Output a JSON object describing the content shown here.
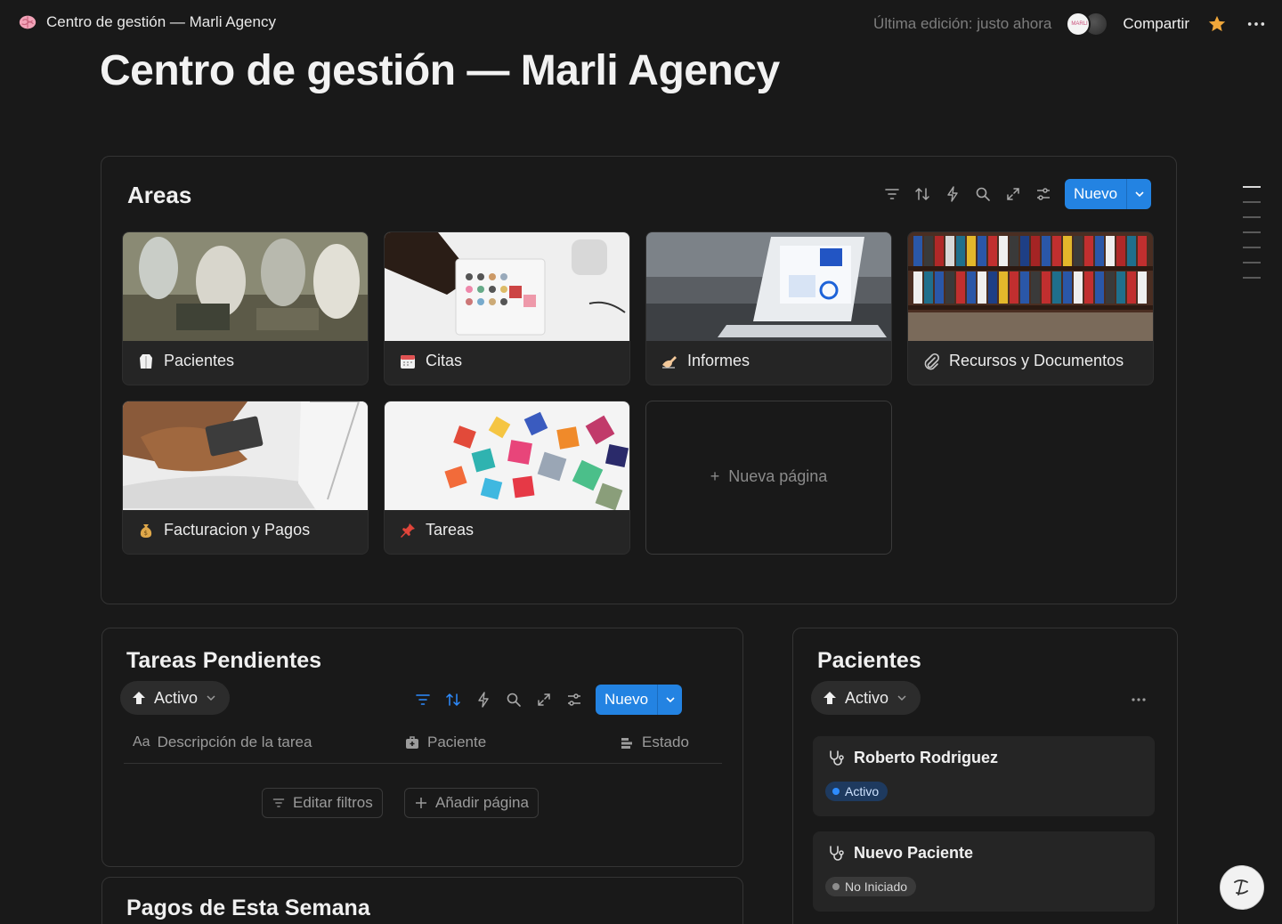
{
  "topbar": {
    "breadcrumb": "Centro de gestión — Marli Agency",
    "last_edit": "Última edición: justo ahora",
    "avatar_label": "MARLI",
    "share": "Compartir"
  },
  "page": {
    "title": "Centro de gestión — Marli Agency"
  },
  "areas": {
    "title": "Areas",
    "new_label": "Nuevo",
    "cards": [
      {
        "label": "Pacientes",
        "icon": "lab-coat-icon"
      },
      {
        "label": "Citas",
        "icon": "calendar-icon"
      },
      {
        "label": "Informes",
        "icon": "writing-hand-icon"
      },
      {
        "label": "Recursos y Documentos",
        "icon": "paperclip-icon"
      },
      {
        "label": "Facturacion y Pagos",
        "icon": "money-bag-icon"
      },
      {
        "label": "Tareas",
        "icon": "pushpin-icon"
      }
    ],
    "new_page": "Nueva página"
  },
  "tareas": {
    "title": "Tareas Pendientes",
    "filter_chip": "Activo",
    "new_label": "Nuevo",
    "columns": [
      "Descripción de la tarea",
      "Paciente",
      "Estado"
    ],
    "edit_filters": "Editar filtros",
    "add_page": "Añadir página"
  },
  "pagos": {
    "title": "Pagos de Esta Semana"
  },
  "pacientes": {
    "title": "Pacientes",
    "filter_chip": "Activo",
    "items": [
      {
        "name": "Roberto Rodriguez",
        "status": "Activo",
        "status_color": "#2e8cff"
      },
      {
        "name": "Nuevo Paciente",
        "status": "No Iniciado",
        "status_color": "#8d8d8d"
      }
    ]
  },
  "colors": {
    "accent": "#2383e2",
    "background": "#191919",
    "card": "#252525"
  }
}
